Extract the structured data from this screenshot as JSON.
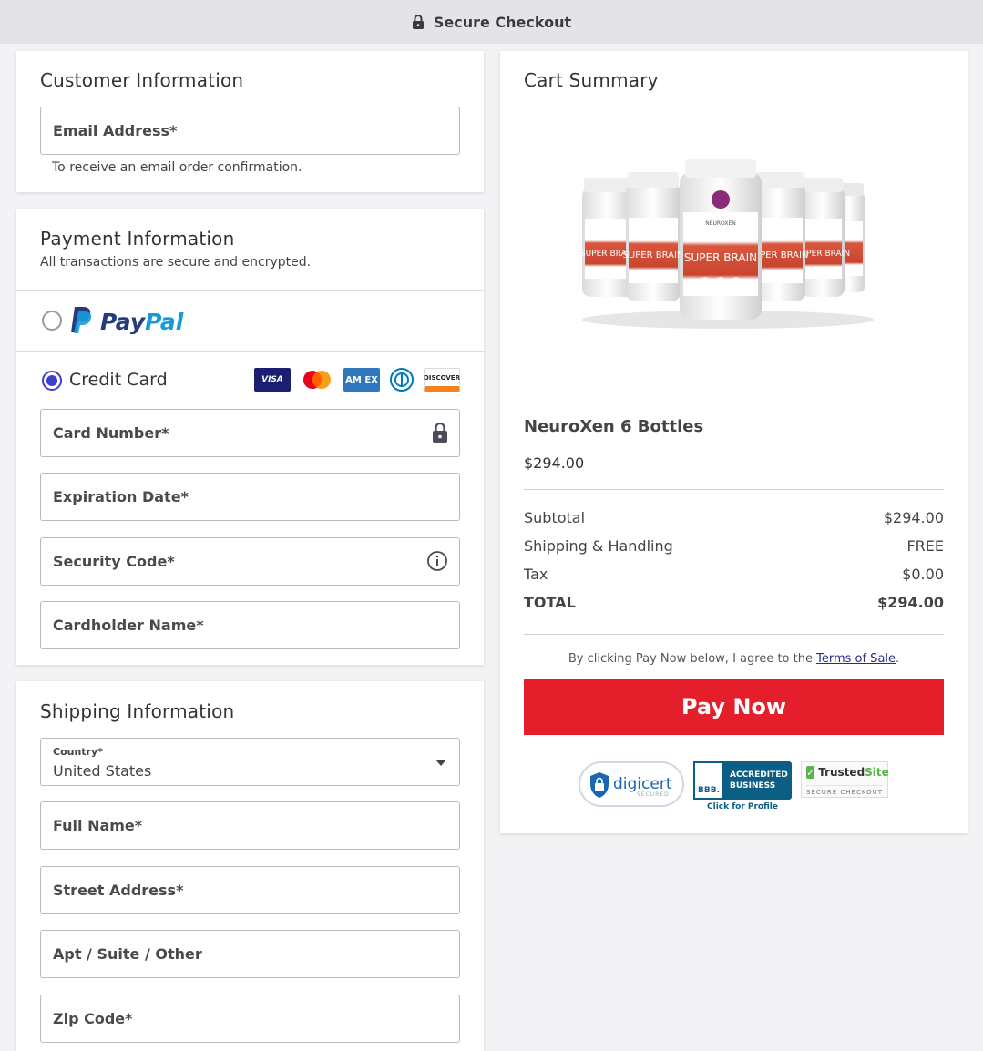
{
  "header": {
    "title": "Secure Checkout",
    "lock_icon": "lock-icon"
  },
  "customer": {
    "title": "Customer Information",
    "email_placeholder": "Email Address*",
    "email_help": "To receive an email order confirmation."
  },
  "payment": {
    "title": "Payment Information",
    "subtitle": "All transactions are secure and encrypted.",
    "paypal": {
      "word1": "Pay",
      "word2": "Pal",
      "selected": false
    },
    "credit_card": {
      "label": "Credit Card",
      "selected": true,
      "logos": [
        {
          "icon": "visa-icon",
          "text": "VISA"
        },
        {
          "icon": "mastercard-icon",
          "text": ""
        },
        {
          "icon": "amex-icon",
          "text": "AM EX"
        },
        {
          "icon": "diners-icon",
          "text": ""
        },
        {
          "icon": "discover-icon",
          "text": "DISCOVER"
        }
      ]
    },
    "card_number_placeholder": "Card Number*",
    "expiration_placeholder": "Expiration Date*",
    "security_code_placeholder": "Security Code*",
    "cardholder_placeholder": "Cardholder Name*"
  },
  "shipping": {
    "title": "Shipping Information",
    "country_label": "Country*",
    "country_value": "United States",
    "full_name_placeholder": "Full Name*",
    "street_placeholder": "Street Address*",
    "apt_placeholder": "Apt / Suite / Other",
    "zip_placeholder": "Zip Code*"
  },
  "cart": {
    "title": "Cart Summary",
    "product_name": "NeuroXen 6 Bottles",
    "product_price": "$294.00",
    "product_label_brand": "NEUROXEN",
    "product_label_name": "SUPER BRAIN",
    "rows": [
      {
        "label": "Subtotal",
        "value": "$294.00"
      },
      {
        "label": "Shipping & Handling",
        "value": "FREE"
      },
      {
        "label": "Tax",
        "value": "$0.00"
      }
    ],
    "total_label": "TOTAL",
    "total_value": "$294.00",
    "terms_prefix": "By clicking Pay Now below, I agree to the ",
    "terms_link": "Terms of Sale",
    "terms_suffix": ".",
    "pay_button": "Pay Now",
    "badges": {
      "digicert": "digicert",
      "digicert_sub": "SECURED",
      "bbb_logo": "BBB.",
      "bbb_line1": "ACCREDITED",
      "bbb_line2": "BUSINESS",
      "bbb_click": "Click for Profile",
      "trusted_word1": "Trusted",
      "trusted_word2": "Site",
      "trusted_sub": "SECURE CHECKOUT"
    }
  },
  "colors": {
    "pay_button": "#e41e2b",
    "radio_selected": "#3f3fcf",
    "paypal_dark": "#253b80",
    "paypal_light": "#179bd7"
  }
}
